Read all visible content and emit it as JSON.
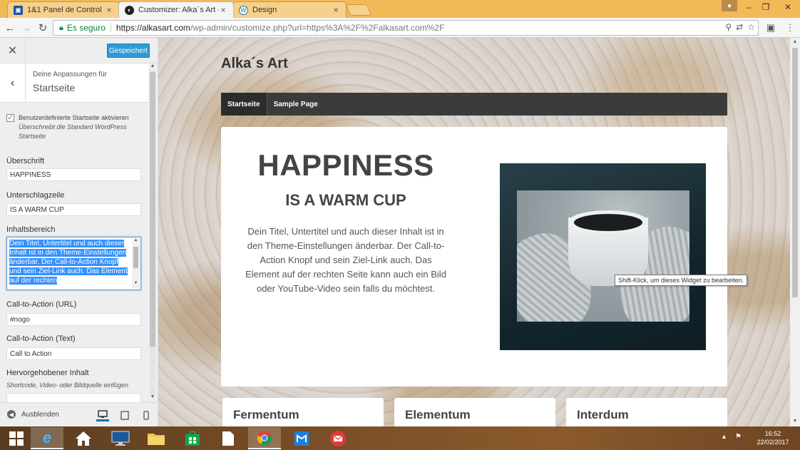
{
  "browser": {
    "tabs": [
      {
        "title": "1&1 Panel de Control",
        "icon": "panel-icon"
      },
      {
        "title": "Customizer: Alka´s Art – ",
        "icon": "wordpress-customizer-icon"
      },
      {
        "title": "Design",
        "icon": "wordpress-icon"
      }
    ],
    "secure_label": "Es seguro",
    "url_host": "https://alkasart.com",
    "url_rest": "/wp-admin/customize.php?url=https%3A%2F%2Falkasart.com%2F"
  },
  "customizer": {
    "saved_label": "Gespeichert",
    "section_subtitle": "Deine Anpassungen für",
    "section_title": "Startseite",
    "checkbox_label": "Benutzerdefinierte Startseite aktivieren",
    "checkbox_checked": true,
    "checkbox_desc": "Überschreibt die Standard WordPress Startseite",
    "heading_label": "Überschrift",
    "heading_value": "HAPPINESS",
    "subheading_label": "Unterschlagzeile",
    "subheading_value": "IS A WARM CUP",
    "content_label": "Inhaltsbereich",
    "content_value": "Dein Titel, Untertitel und auch dieser Inhalt ist in den Theme-Einstellungen änderbar. Der Call-to-Action Knopf und sein Ziel-Link auch. Das Element auf der rechten",
    "cta_url_label": "Call-to-Action (URL)",
    "cta_url_value": "#nogo",
    "cta_text_label": "Call-to-Action (Text)",
    "cta_text_value": "Call to Action",
    "featured_label": "Hervorgehobener Inhalt",
    "featured_hint": "Shortcode, Video- oder Bildquelle einfügen",
    "collapse_label": "Ausblenden"
  },
  "preview": {
    "site_title": "Alka´s Art",
    "nav": [
      "Startseite",
      "Sample Page"
    ],
    "hero_title": "HAPPINESS",
    "hero_subtitle": "IS A WARM CUP",
    "hero_text": "Dein Titel, Untertitel und auch dieser Inhalt ist in den Theme-Einstellungen änderbar. Der Call-to-Action Knopf und sein Ziel-Link auch. Das Element auf der rechten Seite kann auch ein Bild oder YouTube-Video sein falls du möchtest.",
    "tooltip": "Shift-Klick, um dieses Widget zu bearbeiten.",
    "cards": [
      "Fermentum",
      "Elementum",
      "Interdum"
    ]
  },
  "taskbar": {
    "time": "16:52",
    "date": "22/02/2017"
  },
  "colors": {
    "accent": "#2e9bd6",
    "nav_bg": "#3b3b3b",
    "secure_green": "#0b8043"
  }
}
